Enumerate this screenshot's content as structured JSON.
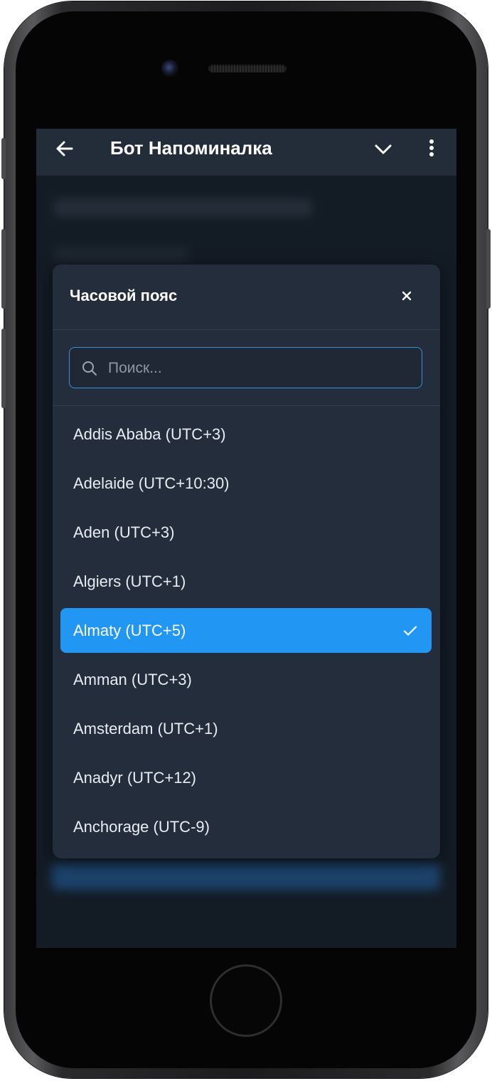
{
  "app": {
    "title": "Бот Напоминалка"
  },
  "dialog": {
    "title": "Часовой пояс",
    "search_placeholder": "Поиск...",
    "search_value": "",
    "selected_index": 4,
    "items": [
      {
        "label": "Addis Ababa (UTC+3)"
      },
      {
        "label": "Adelaide (UTC+10:30)"
      },
      {
        "label": "Aden (UTC+3)"
      },
      {
        "label": "Algiers (UTC+1)"
      },
      {
        "label": "Almaty (UTC+5)"
      },
      {
        "label": "Amman (UTC+3)"
      },
      {
        "label": "Amsterdam (UTC+1)"
      },
      {
        "label": "Anadyr (UTC+12)"
      },
      {
        "label": "Anchorage (UTC-9)"
      }
    ]
  },
  "icons": {
    "back": "arrow-left-icon",
    "collapse": "chevron-down-icon",
    "menu": "more-vertical-icon",
    "close": "close-icon",
    "search": "search-icon",
    "check": "check-icon"
  },
  "colors": {
    "background": "#1b2430",
    "appbar": "#232d3a",
    "dialog": "#232d3b",
    "accent": "#2196f3",
    "search_border": "#3b8fd6"
  }
}
